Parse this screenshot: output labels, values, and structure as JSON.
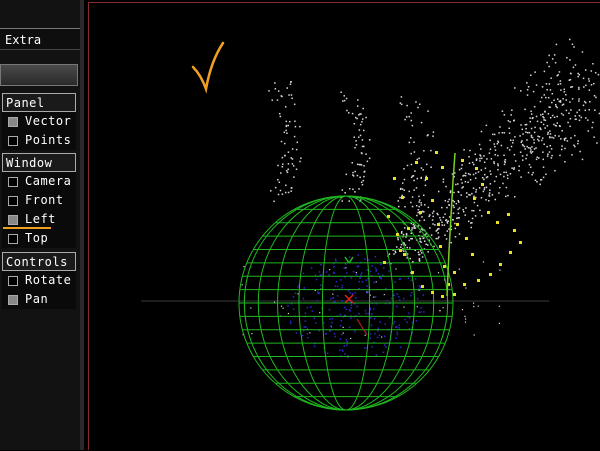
{
  "sidebar": {
    "extra_label": "Extra",
    "panel": {
      "title": "Panel",
      "items": [
        {
          "label": "Vector",
          "checked": true
        },
        {
          "label": "Points",
          "checked": false
        }
      ]
    },
    "window": {
      "title": "Window",
      "items": [
        {
          "label": "Camera",
          "checked": false
        },
        {
          "label": "Front",
          "checked": false
        },
        {
          "label": "Left",
          "checked": true
        },
        {
          "label": "Top",
          "checked": false
        }
      ]
    },
    "controls": {
      "title": "Controls",
      "items": [
        {
          "label": "Rotate",
          "checked": false
        },
        {
          "label": "Pan",
          "checked": true
        }
      ]
    }
  },
  "colors": {
    "sphere": "#1fb81f",
    "points_white": "#d8d8d8",
    "points_yellow": "#e8e020",
    "points_blue": "#2a2ad0",
    "accent": "#f0a020",
    "viewport_border": "#8a2a2a"
  }
}
